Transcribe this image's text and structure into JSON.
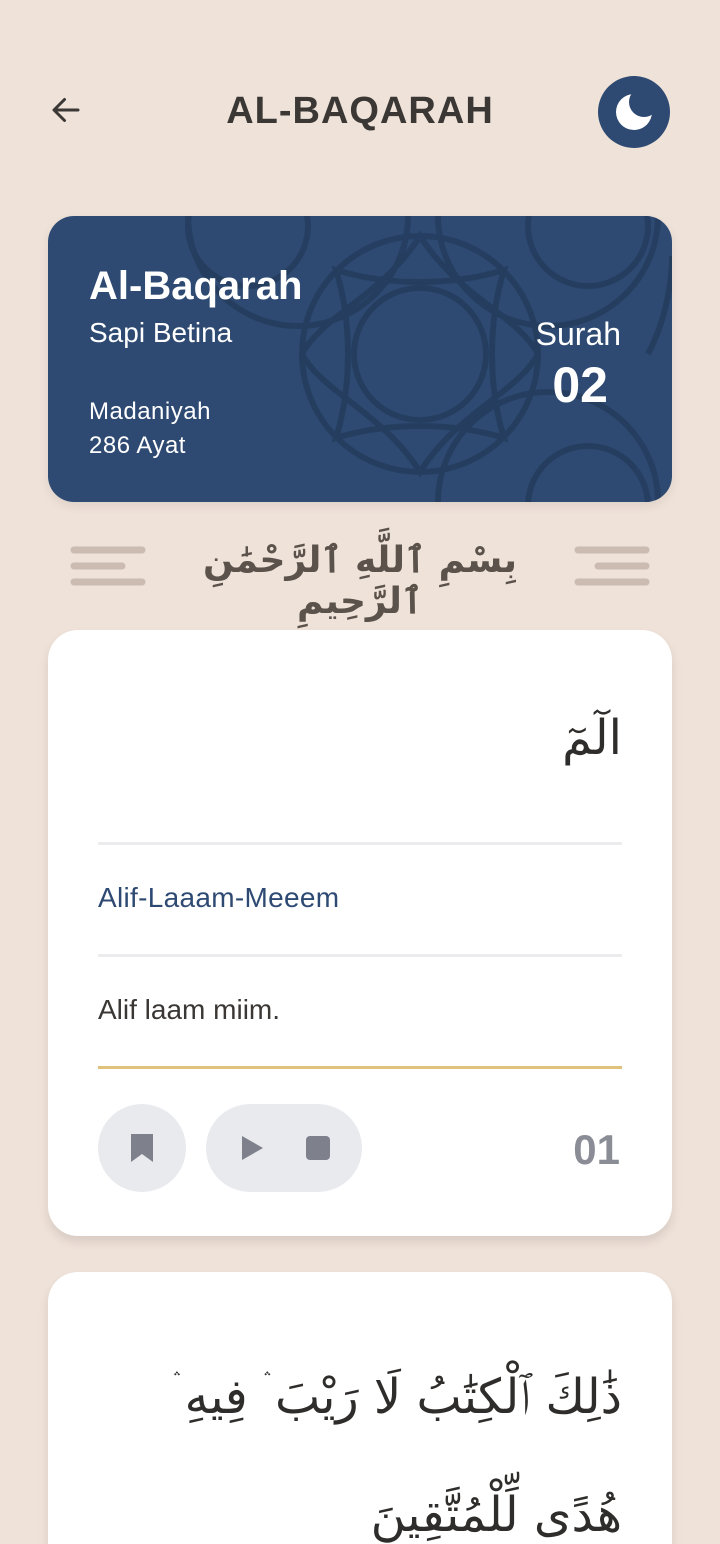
{
  "header": {
    "title": "AL-BAQARAH",
    "back_icon": "arrow-left-icon",
    "theme_icon": "moon-icon"
  },
  "surah": {
    "name": "Al-Baqarah",
    "meaning": "Sapi Betina",
    "revelation": "Madaniyah",
    "ayat_count": "286 Ayat",
    "label": "Surah",
    "number": "02"
  },
  "bismillah": "بِسْمِ ٱللَّهِ ٱلرَّحْمَٰنِ ٱلرَّحِيمِ",
  "ayahs": [
    {
      "arabic": "الٓمٓ",
      "transliteration": "Alif-Laaam-Meeem",
      "translation": "Alif laam miim.",
      "number": "01"
    },
    {
      "arabic": "ذَٰلِكَ ٱلْكِتَٰبُ لَا رَيْبَ ۛ فِيهِ ۛ هُدًى لِّلْمُتَّقِينَ"
    }
  ],
  "colors": {
    "background": "#EFE2D9",
    "primary": "#2E4A72",
    "accent_gold": "#E0C27C",
    "text_dark": "#3A3734",
    "muted": "#8A8C96"
  }
}
